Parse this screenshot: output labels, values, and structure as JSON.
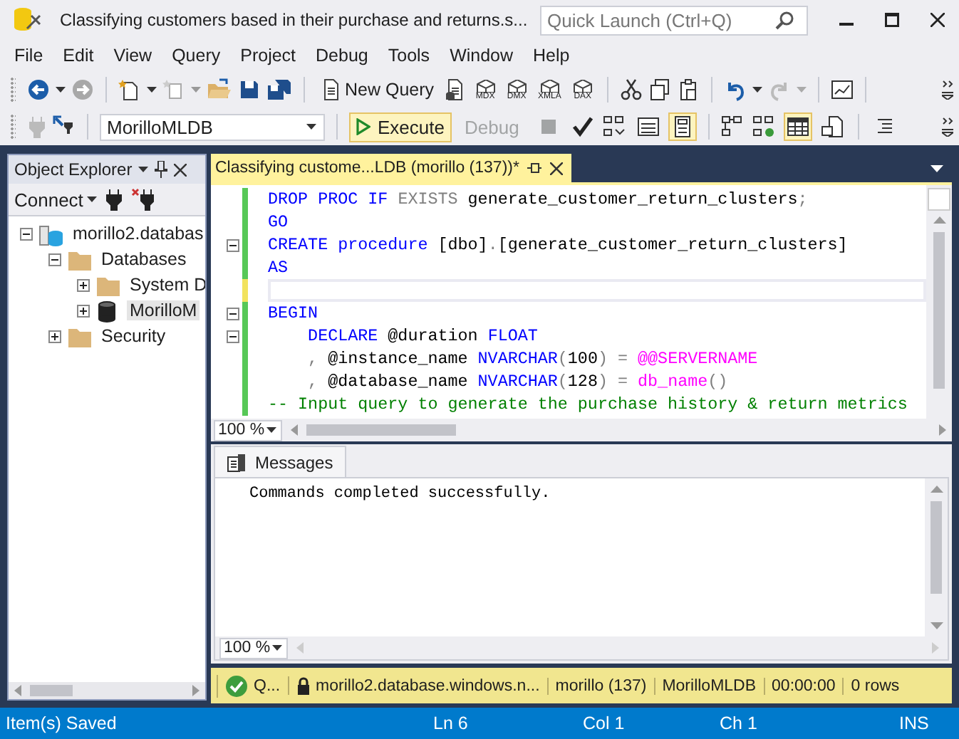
{
  "window": {
    "title": "Classifying customers based in their purchase and returns.s...",
    "quick_launch": {
      "placeholder": "Quick Launch (Ctrl+Q)"
    }
  },
  "menu": [
    "File",
    "Edit",
    "View",
    "Query",
    "Project",
    "Debug",
    "Tools",
    "Window",
    "Help"
  ],
  "toolbar": {
    "new_query": "New Query",
    "query_types": [
      "MDX",
      "DMX",
      "XMLA",
      "DAX"
    ]
  },
  "sql_toolbar": {
    "database": "MorilloMLDB",
    "buttons": [
      {
        "label": "Execute",
        "disabled": false
      },
      {
        "label": "Debug",
        "disabled": true
      }
    ],
    "toggles": [
      {
        "kind": "plan",
        "selected": false
      },
      {
        "kind": "text",
        "selected": false
      },
      {
        "kind": "grid",
        "selected": true
      },
      {
        "kind": "stats",
        "selected": false
      },
      {
        "kind": "table",
        "selected": true
      },
      {
        "kind": "file",
        "selected": false
      }
    ]
  },
  "object_explorer": {
    "title": "Object Explorer",
    "connect": "Connect",
    "tree": [
      {
        "label": "morillo2.databas",
        "kind": "server",
        "expanded": true,
        "selected": false,
        "children": [
          {
            "label": "Databases",
            "kind": "folder",
            "expanded": true,
            "selected": false,
            "children": [
              {
                "label": "System D",
                "kind": "folder",
                "expanded": false,
                "selected": false
              },
              {
                "label": "MorilloM",
                "kind": "database",
                "expanded": false,
                "selected": true
              }
            ]
          },
          {
            "label": "Security",
            "kind": "folder",
            "expanded": false,
            "selected": false
          }
        ]
      }
    ]
  },
  "editor": {
    "tab": {
      "title": "Classifying custome...LDB (morillo (137))*",
      "selected": true
    },
    "zoom": "100 %",
    "lines": [
      {
        "saved": true,
        "fold": false,
        "current": false,
        "tokens": [
          {
            "kind": "keyword",
            "text": "DROP PROC IF "
          },
          {
            "kind": "operator",
            "text": "EXISTS"
          },
          {
            "kind": "plain",
            "text": " generate_customer_return_clusters"
          },
          {
            "kind": "operator",
            "text": ";"
          }
        ]
      },
      {
        "saved": true,
        "fold": false,
        "current": false,
        "tokens": [
          {
            "kind": "keyword",
            "text": "GO"
          }
        ]
      },
      {
        "saved": true,
        "fold": true,
        "current": false,
        "tokens": [
          {
            "kind": "keyword",
            "text": "CREATE procedure"
          },
          {
            "kind": "plain",
            "text": " [dbo]"
          },
          {
            "kind": "operator",
            "text": "."
          },
          {
            "kind": "plain",
            "text": "[generate_customer_return_clusters]"
          }
        ]
      },
      {
        "saved": true,
        "fold": false,
        "current": false,
        "tokens": [
          {
            "kind": "keyword",
            "text": "AS"
          }
        ]
      },
      {
        "saved": false,
        "fold": false,
        "current": true
      },
      {
        "saved": true,
        "fold": true,
        "current": false,
        "tokens": [
          {
            "kind": "keyword",
            "text": "BEGIN"
          }
        ]
      },
      {
        "saved": true,
        "fold": true,
        "current": false,
        "tokens": [
          {
            "kind": "keyword",
            "text": "    DECLARE"
          },
          {
            "kind": "plain",
            "text": " @duration "
          },
          {
            "kind": "keyword",
            "text": "FLOAT"
          }
        ]
      },
      {
        "saved": true,
        "fold": false,
        "current": false,
        "tokens": [
          {
            "kind": "operator",
            "text": "    ,"
          },
          {
            "kind": "plain",
            "text": " @instance_name "
          },
          {
            "kind": "keyword",
            "text": "NVARCHAR"
          },
          {
            "kind": "operator",
            "text": "("
          },
          {
            "kind": "plain",
            "text": "100"
          },
          {
            "kind": "operator",
            "text": ") = "
          },
          {
            "kind": "function",
            "text": "@@SERVERNAME"
          }
        ]
      },
      {
        "saved": true,
        "fold": false,
        "current": false,
        "tokens": [
          {
            "kind": "operator",
            "text": "    ,"
          },
          {
            "kind": "plain",
            "text": " @database_name "
          },
          {
            "kind": "keyword",
            "text": "NVARCHAR"
          },
          {
            "kind": "operator",
            "text": "("
          },
          {
            "kind": "plain",
            "text": "128"
          },
          {
            "kind": "operator",
            "text": ") = "
          },
          {
            "kind": "function",
            "text": "db_name"
          },
          {
            "kind": "operator",
            "text": "()"
          }
        ]
      },
      {
        "saved": true,
        "fold": false,
        "current": false,
        "tokens": [
          {
            "kind": "comment",
            "text": "-- Input query to generate the purchase history & return metrics"
          }
        ]
      }
    ]
  },
  "results": {
    "tabs": [
      {
        "label": "Messages",
        "selected": true
      }
    ],
    "messages": [
      "Commands completed successfully."
    ],
    "zoom": "100 %"
  },
  "query_status": [
    {
      "kind": "success",
      "text": "Q..."
    },
    {
      "kind": "server",
      "text": "morillo2.database.windows.n..."
    },
    {
      "kind": "plain",
      "text": "morillo (137)"
    },
    {
      "kind": "plain",
      "text": "MorilloMLDB"
    },
    {
      "kind": "plain",
      "text": "00:00:00"
    },
    {
      "kind": "plain",
      "text": "0 rows"
    }
  ],
  "status_bar": {
    "message": "Item(s) Saved",
    "line": "Ln 6",
    "column": "Col 1",
    "char": "Ch 1",
    "mode": "INS"
  }
}
